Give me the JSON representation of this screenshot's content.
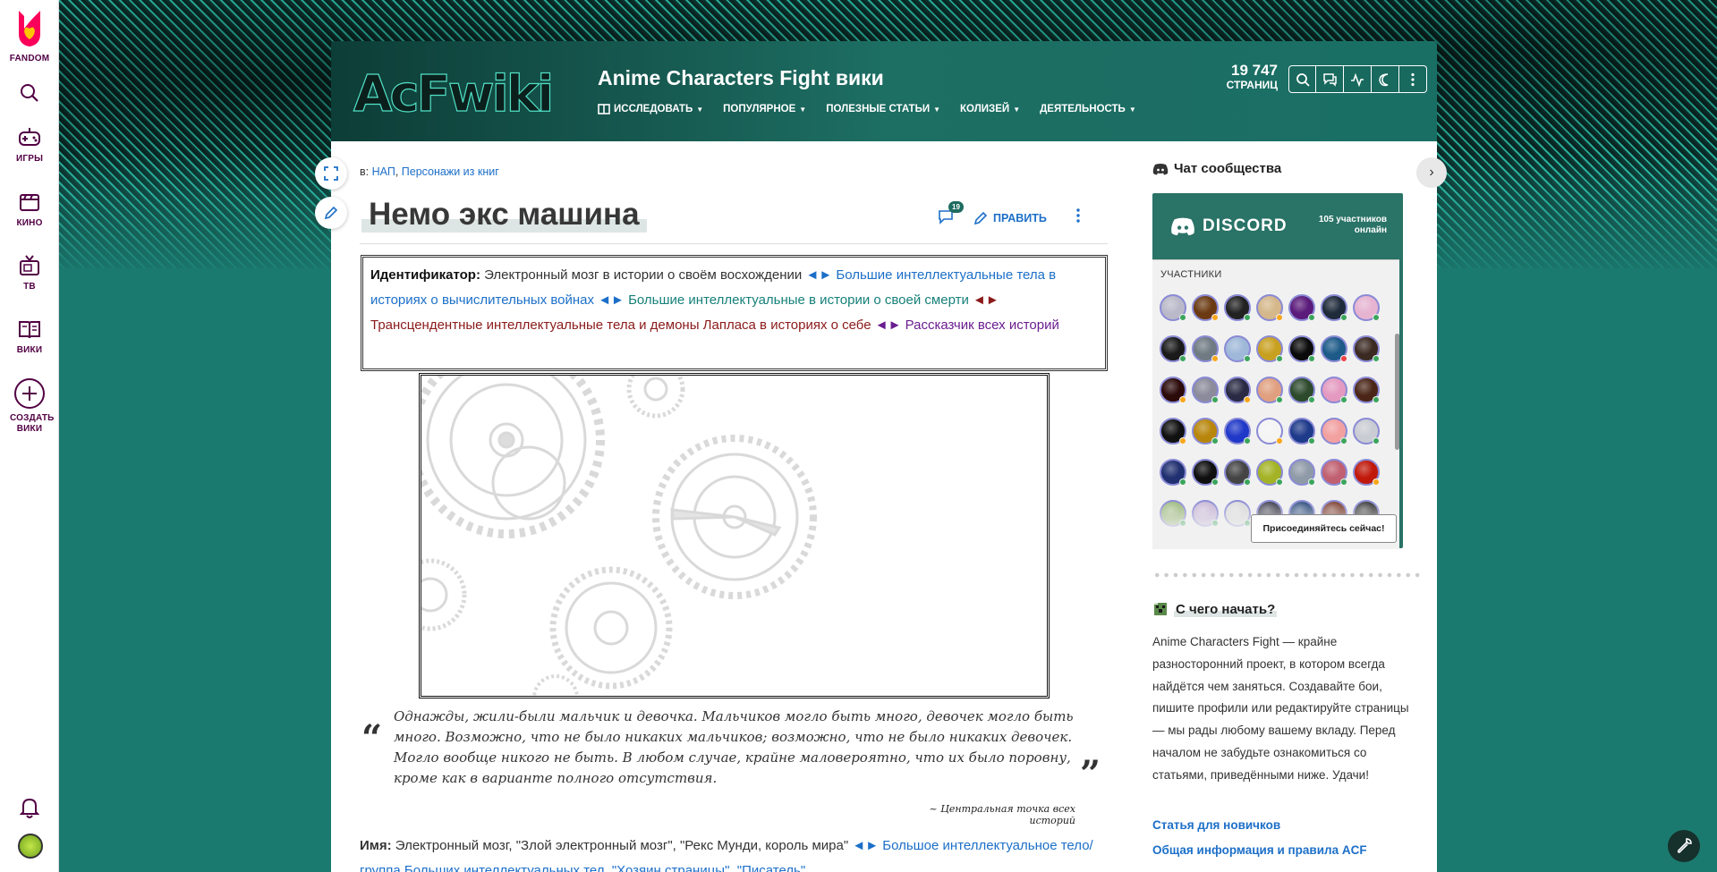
{
  "rail": {
    "fandom_label": "FANDOM",
    "items": [
      {
        "label": "ИГРЫ"
      },
      {
        "label": "КИНО"
      },
      {
        "label": "ТВ"
      },
      {
        "label": "ВИКИ"
      },
      {
        "label": "СОЗДАТЬ ВИКИ"
      }
    ]
  },
  "header": {
    "title": "Anime Characters Fight вики",
    "logo_text": "AcFwiki",
    "nav": [
      "ИССЛЕДОВАТЬ",
      "ПОПУЛЯРНОЕ",
      "ПОЛЕЗНЫЕ СТАТЬИ",
      "КОЛИЗЕЙ",
      "ДЕЯТЕЛЬНОСТЬ"
    ],
    "pages_count": "19 747",
    "pages_label": "СТРАНИЦ"
  },
  "article": {
    "breadcrumb_prefix": "в:",
    "breadcrumb_links": [
      "НАП",
      "Персонажи из книг"
    ],
    "title": "Немо экс машина",
    "comments_count": "19",
    "edit_label": "ПРАВИТЬ",
    "identifier": {
      "label": "Идентификатор:",
      "text": "Электронный мозг в истории о своём восхождении",
      "arrows": "◄►",
      "link1": "Большие интеллектуальные тела в историях о вычислительных войнах",
      "link2": "Большие интеллектуальные в истории о своей смерти",
      "link3": "Трансцендентные интеллектуальные тела и демоны Лапласа в историях о себе",
      "link4": "Рассказчик всех историй"
    },
    "quote": {
      "text": "Однажды, жили-были мальчик и девочка. Мальчиков могло быть много, девочек могло быть много. Возможно, что не было никаких мальчиков; возможно, что не было никаких девочек. Могло вообще никого не быть. В любом случае, крайне маловероятно, что их было поровну, кроме как в варианте полного отсутствия.",
      "source": "~ Центральная точка всех историй",
      "open_mark": "“",
      "close_mark": "”"
    },
    "name": {
      "label": "Имя:",
      "text": "Электронный мозг, \"Злой электронный мозг\", \"Рекс Мунди, король мира\"",
      "arrows": "◄►",
      "link": "Большое интеллектуальное тело/группа Больших интеллектуальных тел, \"Хозяин страницы\", \"Писатель\""
    }
  },
  "sidebar": {
    "chat_title": "Чат сообщества",
    "discord_brand": "DISCORD",
    "online_count": "105 участников",
    "online_label": "онлайн",
    "members_label": "УЧАСТНИКИ",
    "join_label": "Присоединяйтесь сейчас!",
    "start_title": "С чего начать?",
    "start_text": "Anime Characters Fight — крайне разносторонний проект, в котором всегда найдётся чем заняться. Создавайте бои, пишите профили или редактируйте страницы — мы рады любому вашему вкладу. Перед началом не забудьте ознакомиться со статьями, приведёнными ниже. Удачи!",
    "links": [
      "Статья для новичков",
      "Общая информация и правила ACF"
    ]
  },
  "colors": {
    "accent": "#1c6fc8",
    "header_bg": "#1d6e63",
    "brand_purple": "#520044",
    "fandom_pink": "#fa005a"
  },
  "member_avatars": [
    {
      "c": "#b9b9c9",
      "s": "#3aa55c"
    },
    {
      "c": "#6b3a12",
      "s": "#faa61a"
    },
    {
      "c": "#222",
      "s": "#3aa55c"
    },
    {
      "c": "#d4b78a",
      "s": "#faa61a"
    },
    {
      "c": "#5b1b7a",
      "s": "#3aa55c"
    },
    {
      "c": "#1f2a3a",
      "s": "#3aa55c"
    },
    {
      "c": "#e6b3d1",
      "s": "#3aa55c"
    },
    {
      "c": "#1a1a1a",
      "s": "#3aa55c"
    },
    {
      "c": "#6f7a82",
      "s": "#faa61a"
    },
    {
      "c": "#9fb8d9",
      "s": "#3aa55c"
    },
    {
      "c": "#c8a020",
      "s": "#3aa55c"
    },
    {
      "c": "#0a0a0a",
      "s": "#3aa55c"
    },
    {
      "c": "#1d5a88",
      "s": "#ed4245"
    },
    {
      "c": "#3b2a22",
      "s": "#3aa55c"
    },
    {
      "c": "#2b0a0a",
      "s": "#faa61a"
    },
    {
      "c": "#8b8b9b",
      "s": "#3aa55c"
    },
    {
      "c": "#2a2a44",
      "s": "#faa61a"
    },
    {
      "c": "#e0a080",
      "s": "#3aa55c"
    },
    {
      "c": "#2d4a2d",
      "s": "#3aa55c"
    },
    {
      "c": "#e49ac0",
      "s": "#3aa55c"
    },
    {
      "c": "#4b2618",
      "s": "#3aa55c"
    },
    {
      "c": "#111",
      "s": "#faa61a"
    },
    {
      "c": "#b8860b",
      "s": "#3aa55c"
    },
    {
      "c": "#2038c8",
      "s": "#3aa55c"
    },
    {
      "c": "#f4f4f4",
      "s": "#faa61a"
    },
    {
      "c": "#1e3a8a",
      "s": "#3aa55c"
    },
    {
      "c": "#f2a0a0",
      "s": "#3aa55c"
    },
    {
      "c": "#c9ccd3",
      "s": "#3aa55c"
    },
    {
      "c": "#203070",
      "s": "#3aa55c"
    },
    {
      "c": "#0f0f0f",
      "s": "#3aa55c"
    },
    {
      "c": "#444",
      "s": "#3aa55c"
    },
    {
      "c": "#a3b325",
      "s": "#3aa55c"
    },
    {
      "c": "#8f9aa8",
      "s": "#3aa55c"
    },
    {
      "c": "#c06070",
      "s": "#3aa55c"
    },
    {
      "c": "#c0180a",
      "s": "#faa61a"
    },
    {
      "c": "#9ab87a",
      "s": "#3aa55c"
    },
    {
      "c": "#c7b5d6",
      "s": "#3aa55c"
    },
    {
      "c": "#d9d9d9",
      "s": "#3aa55c"
    },
    {
      "c": "#3a3a4a",
      "s": "#3aa55c"
    },
    {
      "c": "#2a4a7a",
      "s": "#3aa55c"
    },
    {
      "c": "#7a3a2a",
      "s": "#3aa55c"
    },
    {
      "c": "#333",
      "s": "#3aa55c"
    }
  ]
}
